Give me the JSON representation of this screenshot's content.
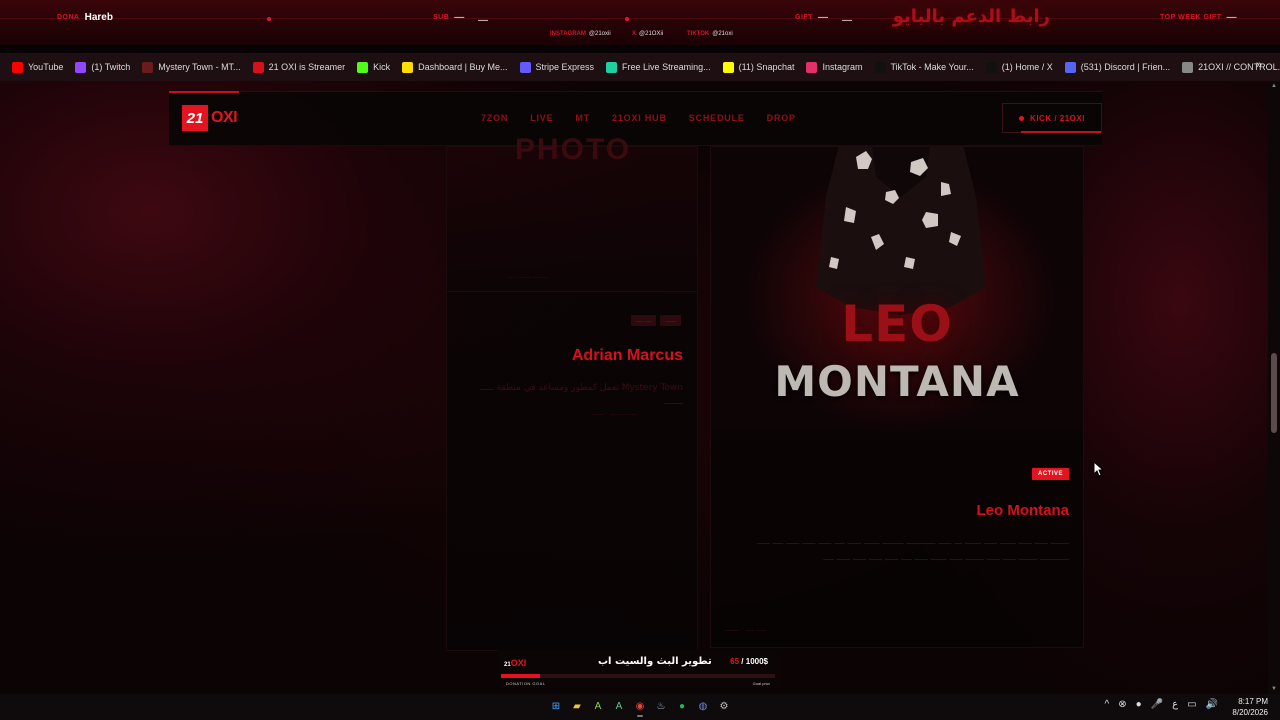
{
  "overlay": {
    "items": [
      {
        "label": "DONA",
        "value": "Hareb"
      },
      {
        "label": "SUB",
        "value": "—"
      },
      {
        "label": "GIFT",
        "value": "—"
      },
      {
        "label": "TOP WEEK GIFT",
        "value": "—"
      }
    ],
    "socials": [
      {
        "platform": "INSTAGRAM",
        "handle": "@21oxii"
      },
      {
        "platform": "X",
        "handle": "@21OXii"
      },
      {
        "platform": "TIKTOK",
        "handle": "@21oxi"
      }
    ],
    "arabic_link": "رابط الدعم بالبايو"
  },
  "bookmarks": [
    {
      "label": "YouTube",
      "icon": "youtube-icon",
      "color": "#ff0000"
    },
    {
      "label": "(1) Twitch",
      "icon": "twitch-icon",
      "color": "#9146ff"
    },
    {
      "label": "Mystery Town - MT...",
      "icon": "mystery-town-icon",
      "color": "#6b1b1b"
    },
    {
      "label": "21 OXI is Streamer",
      "icon": "streamer-icon",
      "color": "#d4111d"
    },
    {
      "label": "Kick",
      "icon": "kick-icon",
      "color": "#53fc18"
    },
    {
      "label": "Dashboard | Buy Me...",
      "icon": "buymeacoffee-icon",
      "color": "#ffdd00"
    },
    {
      "label": "Stripe Express",
      "icon": "stripe-icon",
      "color": "#635bff"
    },
    {
      "label": "Free Live Streaming...",
      "icon": "streaming-icon",
      "color": "#1dd1a1"
    },
    {
      "label": "(11) Snapchat",
      "icon": "snapchat-icon",
      "color": "#fffc00"
    },
    {
      "label": "Instagram",
      "icon": "instagram-icon",
      "color": "#e1306c"
    },
    {
      "label": "TikTok - Make Your...",
      "icon": "tiktok-icon",
      "color": "#111111"
    },
    {
      "label": "(1) Home / X",
      "icon": "x-icon",
      "color": "#111111"
    },
    {
      "label": "(531) Discord | Frien...",
      "icon": "discord-icon",
      "color": "#5865f2"
    },
    {
      "label": "21OXI // CONTROL...",
      "icon": "globe-icon",
      "color": "#888888"
    }
  ],
  "site": {
    "logo_num": "21",
    "logo_text": "OXI",
    "nav": [
      "7ZON",
      "LIVE",
      "MT",
      "21OXI HUB",
      "SCHEDULE",
      "DROP"
    ],
    "cta": "KICK / 21OXI"
  },
  "cards": {
    "left": {
      "photo_label": "PHOTO",
      "tags": [
        "ــــ ــــ",
        "ــــــ"
      ],
      "name": "Adrian Marcus",
      "description": "Mystery Town تعمل كمطور ومساعد في منطقة ـــــ ـــــــ",
      "meta": "ـــــــ ـــــ · ــــــ"
    },
    "right": {
      "poster_line1": "LEO",
      "poster_line2": "MONTANA",
      "tag": "ACTIVE",
      "name": "Leo Montana",
      "description": "ـــــــ ـــــ ـــــ ــــــ ـــــ ــــــ ـــ ـــــ ـــــــــــ ــــــــ ــــــ ـــــ ــــ ـــــ ـــــ ـــــ ــــ ـــــ ـــــــــــ ـــــــ ـــــ ـــــ ـــــــ ـــــ ــــــ ـــــ ــــ ـــــ ـــــ ـــــ ـــــ ــــ",
      "meta": "ـــــ ــــ · ـــــــ"
    }
  },
  "donation": {
    "logo_num": "21",
    "logo_text": "OXI",
    "title": "تطوير البث والسيت اب",
    "current": "65",
    "goal": "/ 1000$",
    "progress": 0.065,
    "label": "DONATION GOAL",
    "right_label": "Goal prov"
  },
  "taskbar": {
    "apps": [
      {
        "icon": "windows-start-icon",
        "glyph": "⊞",
        "color": "#4aa3ff"
      },
      {
        "icon": "file-explorer-icon",
        "glyph": "▰",
        "color": "#f5c242"
      },
      {
        "icon": "app-a-icon",
        "glyph": "A",
        "color": "#8ccf5a"
      },
      {
        "icon": "app-a2-icon",
        "glyph": "A",
        "color": "#5ac88f"
      },
      {
        "icon": "chrome-icon",
        "glyph": "◉",
        "color": "#ea4335"
      },
      {
        "icon": "steam-icon",
        "glyph": "♨",
        "color": "#9ecbe8"
      },
      {
        "icon": "spotify-icon",
        "glyph": "●",
        "color": "#1db954"
      },
      {
        "icon": "discord-icon",
        "glyph": "◍",
        "color": "#7289da"
      },
      {
        "icon": "settings-icon",
        "glyph": "⚙",
        "color": "#bbbbbb"
      }
    ],
    "tray": [
      "^",
      "⊗",
      "●",
      "🎤",
      "ع",
      "▭",
      "🔊"
    ],
    "time": "8:17 PM",
    "date": "8/20/2026"
  }
}
